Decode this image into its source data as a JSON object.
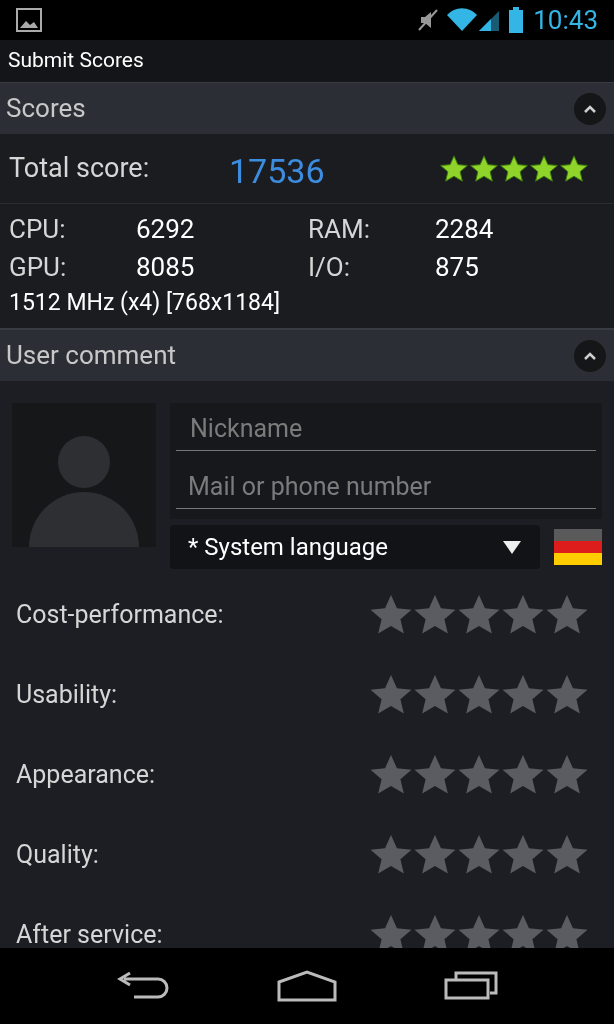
{
  "status_bar": {
    "time": "10:43"
  },
  "title": "Submit Scores",
  "scores_section": {
    "title": "Scores",
    "expanded": true,
    "total_label": "Total score:",
    "total_value": "17536",
    "stars": 5,
    "stats": [
      {
        "label": "CPU:",
        "value": "6292"
      },
      {
        "label": "RAM:",
        "value": "2284"
      },
      {
        "label": "GPU:",
        "value": "8085"
      },
      {
        "label": "I/O:",
        "value": "875"
      }
    ],
    "device_info": "1512 MHz (x4) [768x1184]"
  },
  "comment_section": {
    "title": "User comment",
    "expanded": true,
    "nickname": {
      "placeholder": "Nickname"
    },
    "contact": {
      "placeholder": "Mail or phone number"
    },
    "language": "* System language",
    "ratings": [
      {
        "label": "Cost-performance:",
        "stars": 0
      },
      {
        "label": "Usability:",
        "stars": 0
      },
      {
        "label": "Appearance:",
        "stars": 0
      },
      {
        "label": "Quality:",
        "stars": 0
      },
      {
        "label": "After service:",
        "stars": 0
      }
    ]
  }
}
